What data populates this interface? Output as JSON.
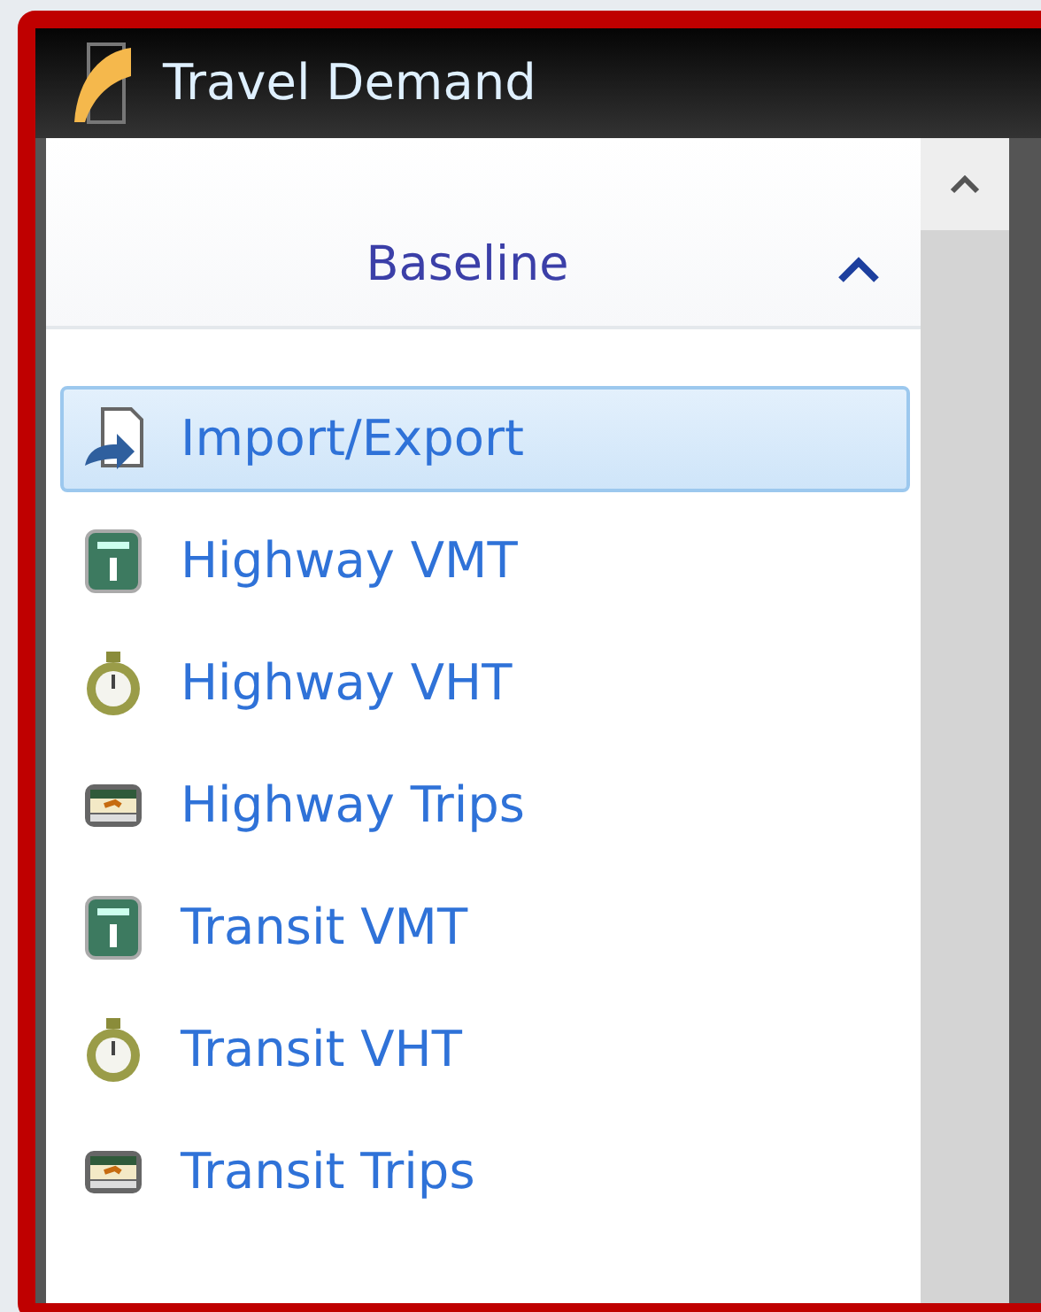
{
  "window": {
    "title": "Travel Demand"
  },
  "section": {
    "title": "Baseline",
    "expanded": true
  },
  "items": [
    {
      "label": "Import/Export",
      "kind": "import",
      "selected": true
    },
    {
      "label": "Highway VMT",
      "kind": "mile",
      "selected": false
    },
    {
      "label": "Highway VHT",
      "kind": "stopwatch",
      "selected": false
    },
    {
      "label": "Highway Trips",
      "kind": "ticket",
      "selected": false
    },
    {
      "label": "Transit VMT",
      "kind": "mile",
      "selected": false
    },
    {
      "label": "Transit VHT",
      "kind": "stopwatch",
      "selected": false
    },
    {
      "label": "Transit Trips",
      "kind": "ticket",
      "selected": false
    }
  ]
}
